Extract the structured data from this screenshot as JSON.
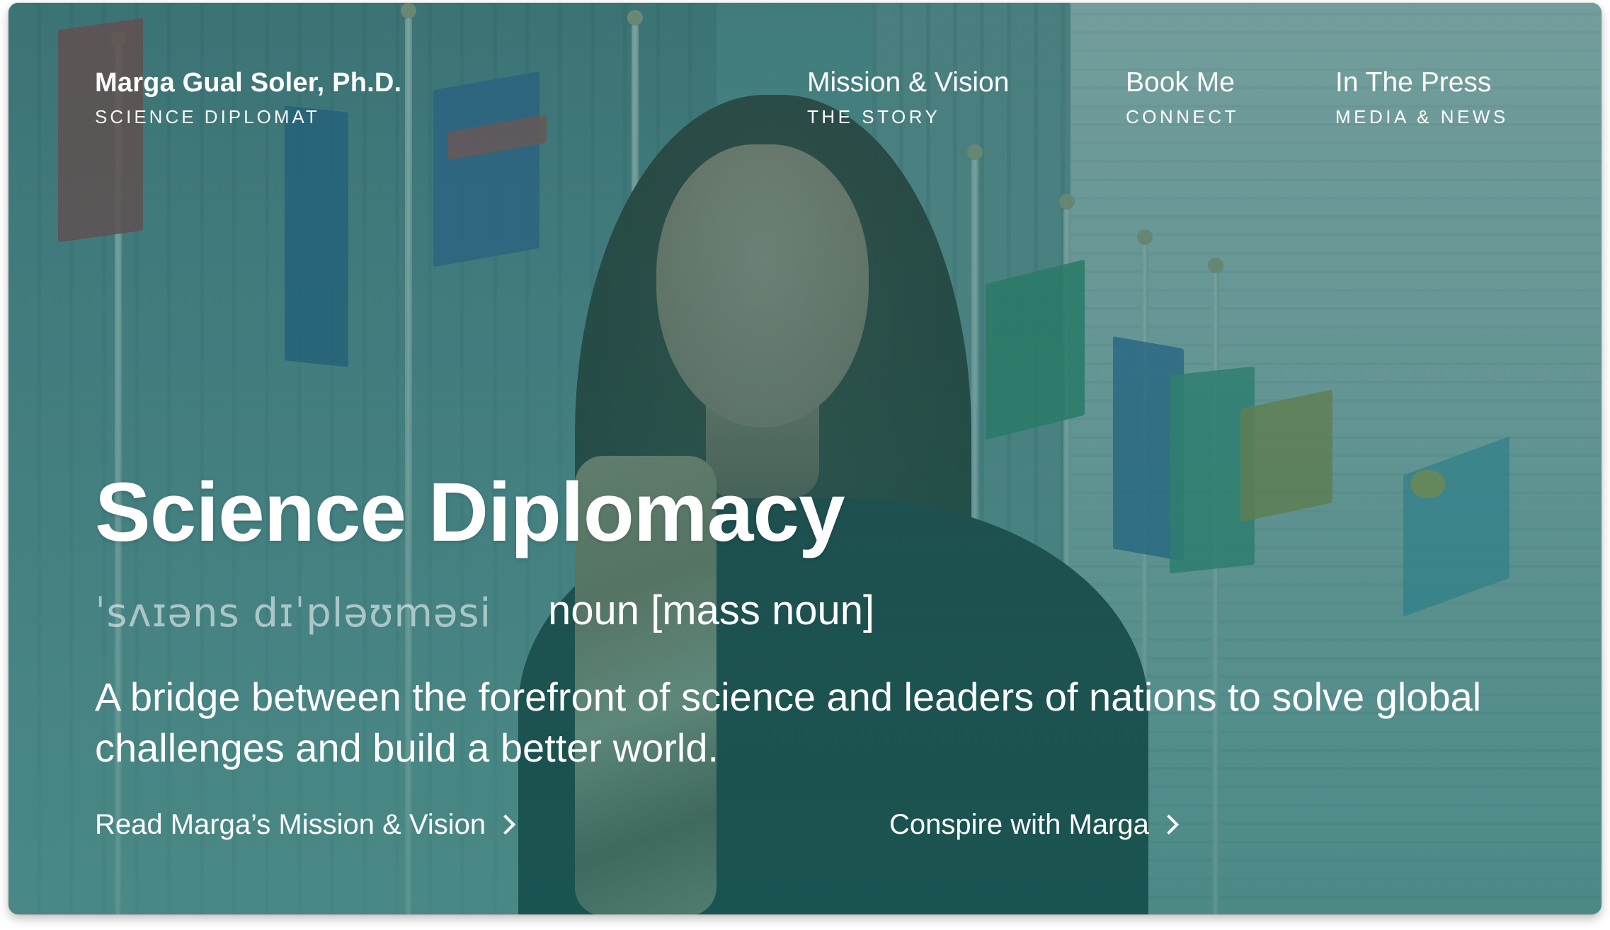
{
  "brand": {
    "name": "Marga Gual Soler, Ph.D.",
    "tagline": "SCIENCE DIPLOMAT"
  },
  "nav": [
    {
      "title": "Mission & Vision",
      "subtitle": "THE STORY"
    },
    {
      "title": "Book Me",
      "subtitle": "CONNECT"
    },
    {
      "title": "In The Press",
      "subtitle": "MEDIA & NEWS"
    }
  ],
  "hero": {
    "title": "Science Diplomacy",
    "pronunciation": "ˈsʌɪəns dɪˈpləʊməsi",
    "part_of_speech": "noun [mass noun]",
    "definition": "A bridge between the forefront of science and leaders of nations to solve global challenges and build a better world."
  },
  "cta": {
    "mission_link": "Read Marga’s Mission & Vision",
    "conspire_link": "Conspire with Marga"
  },
  "icons": {
    "chevron": "chevron-right-icon"
  },
  "colors": {
    "overlay": "#1c6060",
    "text": "#ffffff"
  }
}
